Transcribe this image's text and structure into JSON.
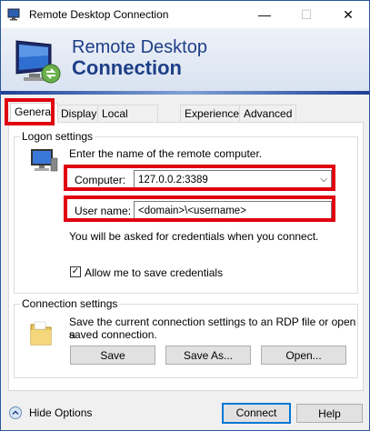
{
  "window": {
    "title": "Remote Desktop Connection",
    "controls": {
      "minimize": "—",
      "maximize": "☐",
      "close": "✕"
    }
  },
  "banner": {
    "line1": "Remote Desktop",
    "line2": "Connection"
  },
  "tabs": [
    {
      "label": "General",
      "active": true
    },
    {
      "label": "Display",
      "active": false
    },
    {
      "label": "Local Resources",
      "active": false
    },
    {
      "label": "Experience",
      "active": false
    },
    {
      "label": "Advanced",
      "active": false
    }
  ],
  "logon": {
    "group_label": "Logon settings",
    "instruction": "Enter the name of the remote computer.",
    "computer_label": "Computer:",
    "computer_value": "127.0.0.2:3389",
    "username_label": "User name:",
    "username_value": "<domain>\\<username>",
    "credentials_note": "You will be asked for credentials when you connect.",
    "save_credentials_label": "Allow me to save credentials",
    "save_credentials_checked": true
  },
  "connection": {
    "group_label": "Connection settings",
    "description_line1": "Save the current connection settings to an RDP file or open a",
    "description_line2": "saved connection.",
    "save_label": "Save",
    "save_as_label": "Save As...",
    "open_label": "Open..."
  },
  "footer": {
    "hide_options_label": "Hide Options",
    "connect_label": "Connect",
    "help_label": "Help"
  },
  "colors": {
    "highlight": "#e00010",
    "brand": "#1d3f87"
  }
}
